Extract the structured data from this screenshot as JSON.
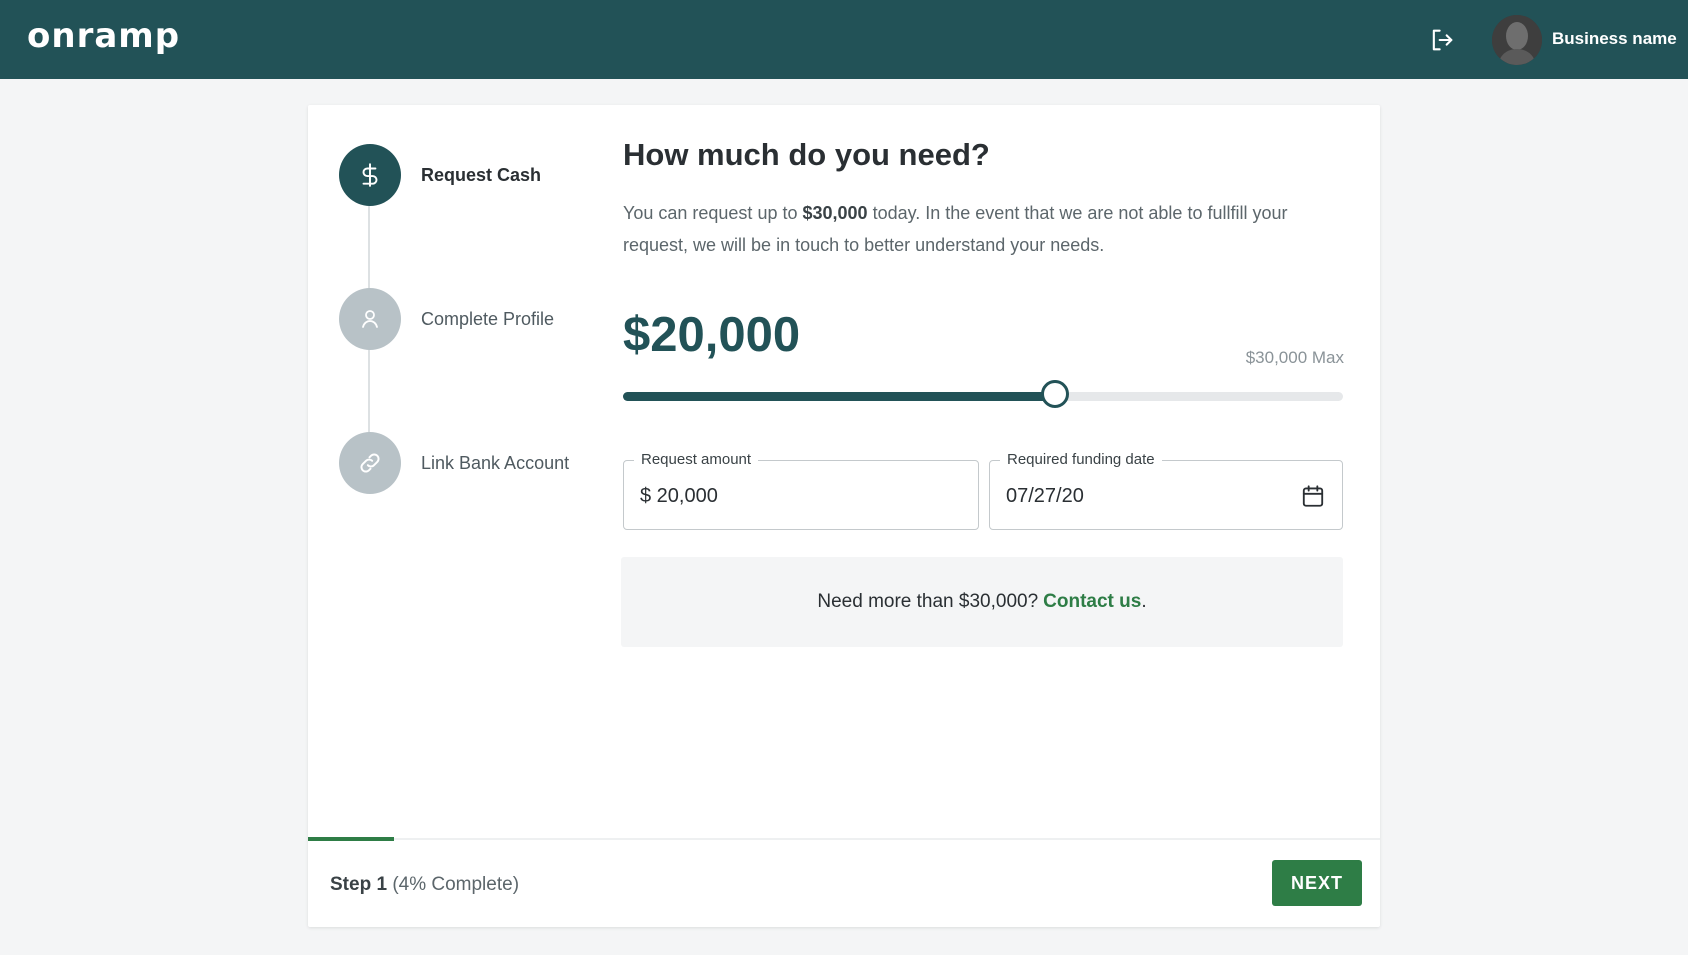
{
  "header": {
    "logo": "onramp",
    "business_name": "Business name"
  },
  "stepper": {
    "steps": [
      {
        "label": "Request Cash",
        "icon": "dollar-icon",
        "status": "active"
      },
      {
        "label": "Complete Profile",
        "icon": "user-icon",
        "status": "inactive"
      },
      {
        "label": "Link Bank Account",
        "icon": "link-icon",
        "status": "inactive"
      }
    ]
  },
  "main": {
    "title": "How much do you need?",
    "description_before": "You can request up to ",
    "description_amount": "$30,000",
    "description_after": " today. In the event that we are not able to fullfill your request, we will be in touch to better understand your needs.",
    "amount_display": "$20,000",
    "max_label": "$30,000 Max",
    "slider": {
      "min": 0,
      "max": 30000,
      "value": 20000,
      "fraction": 0.6
    },
    "request_amount": {
      "label": "Request amount",
      "value": "$ 20,000"
    },
    "funding_date": {
      "label": "Required funding date",
      "value": "07/27/20"
    },
    "info_text": "Need more than $30,000?",
    "info_link": "Contact us",
    "info_end": "."
  },
  "footer": {
    "step_label": "Step 1",
    "progress_text": "(4% Complete)",
    "progress_percent": 4,
    "progress_bar_fraction": 0.08,
    "next_label": "NEXT"
  },
  "colors": {
    "header_bg": "#225257",
    "primary": "#225257",
    "accent_green": "#2e7d46",
    "page_bg": "#f4f5f6"
  }
}
